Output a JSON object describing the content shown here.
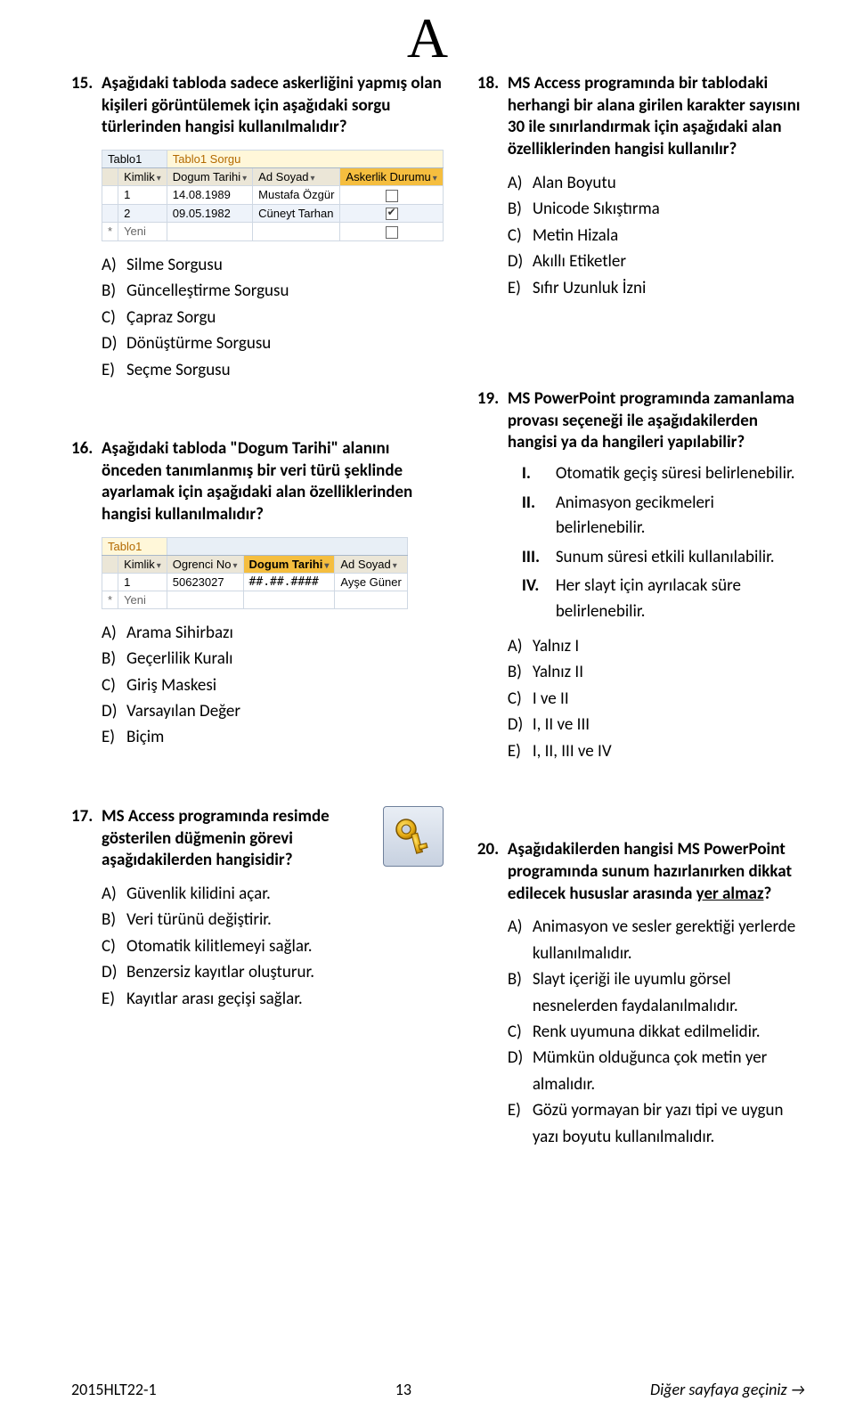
{
  "header_letter": "A",
  "q15": {
    "num": "15.",
    "text": "Aşağıdaki tabloda sadece askerliğini yapmış olan kişileri görüntülemek için aşağıdaki sorgu türlerinden hangisi kullanılmalıdır?",
    "tabs": {
      "t1": "Tablo1",
      "t2": "Tablo1 Sorgu"
    },
    "hdr": {
      "c1": "Kimlik",
      "c2": "Dogum Tarihi",
      "c3": "Ad Soyad",
      "c4": "Askerlik Durumu"
    },
    "rows": {
      "r1": {
        "c1": "1",
        "c2": "14.08.1989",
        "c3": "Mustafa Özgür"
      },
      "r2": {
        "c1": "2",
        "c2": "09.05.1982",
        "c3": "Cüneyt Tarhan"
      },
      "r3": {
        "c1": "Yeni"
      }
    },
    "opts": {
      "a": "Silme Sorgusu",
      "b": "Güncelleştirme Sorgusu",
      "c": "Çapraz Sorgu",
      "d": "Dönüştürme Sorgusu",
      "e": "Seçme Sorgusu"
    }
  },
  "q18": {
    "num": "18.",
    "text": "MS Access programında bir tablodaki herhangi bir alana girilen karakter sayısını 30 ile sınırlandırmak için aşağıdaki alan özelliklerinden hangisi kullanılır?",
    "opts": {
      "a": "Alan Boyutu",
      "b": "Unicode Sıkıştırma",
      "c": "Metin Hizala",
      "d": "Akıllı Etiketler",
      "e": "Sıfır Uzunluk İzni"
    }
  },
  "q16": {
    "num": "16.",
    "text": "Aşağıdaki tabloda \"Dogum Tarihi\" alanını önceden tanımlanmış bir veri türü şeklinde ayarlamak için aşağıdaki alan özelliklerinden hangisi kullanılmalıdır?",
    "tab": "Tablo1",
    "hdr": {
      "c1": "Kimlik",
      "c2": "Ogrenci No",
      "c3": "Dogum Tarihi",
      "c4": "Ad Soyad"
    },
    "row": {
      "c1": "1",
      "c2": "50623027",
      "c3": "##.##.####",
      "c4": "Ayşe Güner"
    },
    "newrow": "Yeni",
    "opts": {
      "a": "Arama Sihirbazı",
      "b": "Geçerlilik Kuralı",
      "c": "Giriş Maskesi",
      "d": "Varsayılan Değer",
      "e": "Biçim"
    }
  },
  "q19": {
    "num": "19.",
    "text": "MS PowerPoint programında zamanlama provası seçeneği ile aşağıdakilerden hangisi ya da hangileri yapılabilir?",
    "sub": {
      "i": {
        "n": "I.",
        "t": "Otomatik geçiş süresi belirlenebilir."
      },
      "ii": {
        "n": "II.",
        "t": "Animasyon gecikmeleri belirlenebilir."
      },
      "iii": {
        "n": "III.",
        "t": "Sunum süresi etkili kullanılabilir."
      },
      "iv": {
        "n": "IV.",
        "t": "Her slayt için ayrılacak süre belirlenebilir."
      }
    },
    "opts": {
      "a": "Yalnız I",
      "b": "Yalnız II",
      "c": "I ve II",
      "d": "I, II ve III",
      "e": "I, II, III ve IV"
    }
  },
  "q17": {
    "num": "17.",
    "text": "MS Access programında resimde gösterilen düğmenin görevi aşağıdakilerden hangisidir?",
    "opts": {
      "a": "Güvenlik kilidini açar.",
      "b": "Veri türünü değiştirir.",
      "c": "Otomatik kilitlemeyi sağlar.",
      "d": "Benzersiz kayıtlar oluşturur.",
      "e": "Kayıtlar arası geçişi sağlar."
    }
  },
  "q20": {
    "num": "20.",
    "text_pre": "Aşağıdakilerden hangisi MS PowerPoint programında sunum hazırlanırken dikkat edilecek hususlar arasında ",
    "text_und": "yer almaz",
    "text_post": "?",
    "opts": {
      "a": "Animasyon ve sesler gerektiği yerlerde kullanılmalıdır.",
      "b": "Slayt içeriği ile uyumlu görsel nesnelerden faydalanılmalıdır.",
      "c": "Renk uyumuna dikkat edilmelidir.",
      "d": "Mümkün olduğunca çok metin yer almalıdır.",
      "e": "Gözü yormayan bir yazı tipi ve uygun yazı boyutu kullanılmalıdır."
    }
  },
  "footer": {
    "left": "2015HLT22-1",
    "center": "13",
    "right": "Diğer sayfaya geçiniz →"
  },
  "labels": {
    "A": "A)",
    "B": "B)",
    "C": "C)",
    "D": "D)",
    "E": "E)"
  }
}
